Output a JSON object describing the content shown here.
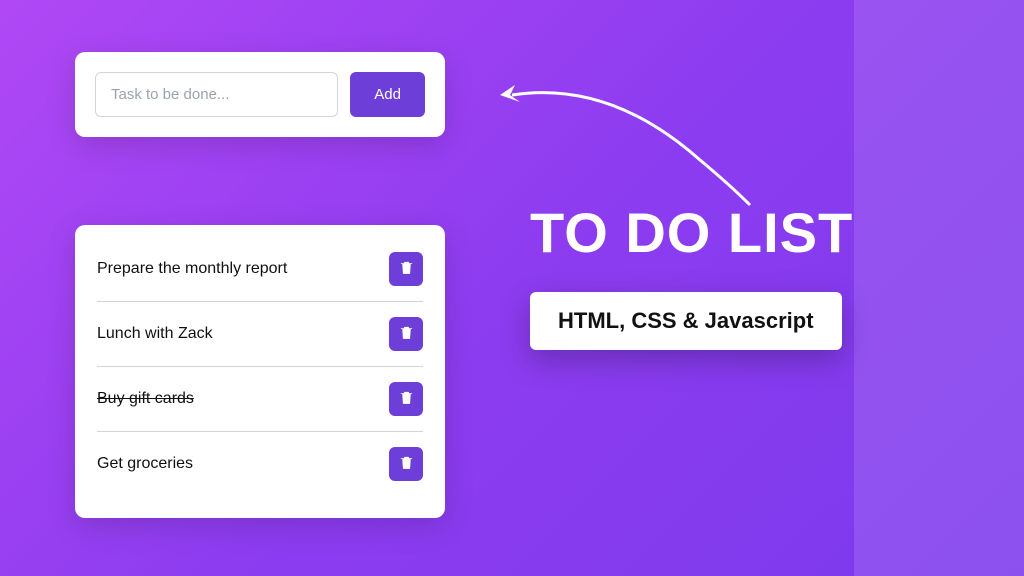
{
  "input": {
    "placeholder": "Task to be done...",
    "button_label": "Add"
  },
  "tasks": [
    {
      "text": "Prepare the monthly report",
      "completed": false
    },
    {
      "text": "Lunch with Zack",
      "completed": false
    },
    {
      "text": "Buy gift cards",
      "completed": true
    },
    {
      "text": "Get groceries",
      "completed": false
    }
  ],
  "hero": {
    "title": "TO DO LIST",
    "subtitle": "HTML, CSS & Javascript"
  },
  "colors": {
    "accent": "#6d3fd8",
    "gradient_start": "#b048f5",
    "gradient_end": "#7c3aed"
  }
}
